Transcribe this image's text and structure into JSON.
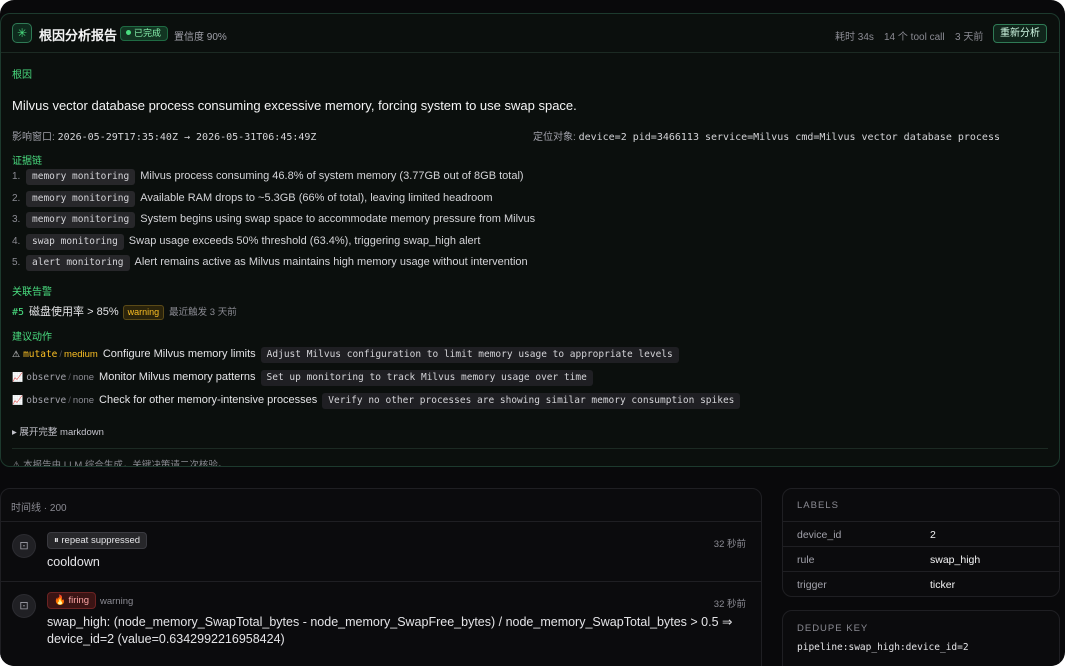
{
  "report": {
    "title": "根因分析报告",
    "status": "已完成",
    "confidence": "置信度 90%",
    "duration": "耗时 34s",
    "tool_calls": "14 个 tool call",
    "age": "3 天前",
    "rerun_label": "重新分析",
    "root_cause_label": "根因",
    "root_cause": "Milvus vector database process consuming excessive memory, forcing system to use swap space.",
    "window_label": "影响窗口:",
    "window_value": "2026-05-29T17:35:40Z → 2026-05-31T06:45:49Z",
    "target_label": "定位对象:",
    "target_value": "device=2 pid=3466113 service=Milvus cmd=Milvus vector database process",
    "evidence_label": "证据链",
    "evidence": [
      {
        "num": "1.",
        "tag": "memory monitoring",
        "text": "Milvus process consuming 46.8% of system memory (3.77GB out of 8GB total)"
      },
      {
        "num": "2.",
        "tag": "memory monitoring",
        "text": "Available RAM drops to ~5.3GB (66% of total), leaving limited headroom"
      },
      {
        "num": "3.",
        "tag": "memory monitoring",
        "text": "System begins using swap space to accommodate memory pressure from Milvus"
      },
      {
        "num": "4.",
        "tag": "swap monitoring",
        "text": "Swap usage exceeds 50% threshold (63.4%), triggering swap_high alert"
      },
      {
        "num": "5.",
        "tag": "alert monitoring",
        "text": "Alert remains active as Milvus maintains high memory usage without intervention"
      }
    ],
    "related_label": "关联告警",
    "related": {
      "id": "#5",
      "text": "磁盘使用率 > 85%",
      "severity": "warning",
      "when": "最近触发 3 天前"
    },
    "actions_label": "建议动作",
    "actions": [
      {
        "icon": "⚠",
        "kind": "mutate",
        "risk": "medium",
        "title": "Configure Milvus memory limits",
        "detail": "Adjust Milvus configuration to limit memory usage to appropriate levels"
      },
      {
        "icon": "📈",
        "kind": "observe",
        "risk": "none",
        "title": "Monitor Milvus memory patterns",
        "detail": "Set up monitoring to track Milvus memory usage over time"
      },
      {
        "icon": "📈",
        "kind": "observe",
        "risk": "none",
        "title": "Check for other memory-intensive processes",
        "detail": "Verify no other processes are showing similar memory consumption spikes"
      }
    ],
    "expand_label": "▸ 展开完整 markdown",
    "disclaimer": "⚠ 本报告由 LLM 综合生成，关键决策请二次核验。"
  },
  "timeline": {
    "header": "时间线 · 200",
    "events": [
      {
        "pill": "⏸ repeat suppressed",
        "severity": "",
        "time": "32 秒前",
        "body": "cooldown"
      },
      {
        "pill": "🔥 firing",
        "severity": "warning",
        "time": "32 秒前",
        "body": "swap_high: (node_memory_SwapTotal_bytes - node_memory_SwapFree_bytes) / node_memory_SwapTotal_bytes > 0.5 ⇒ device_id=2 (value=0.6342992216958424)"
      }
    ]
  },
  "labels": {
    "title": "LABELS",
    "rows": [
      {
        "key": "device_id",
        "value": "2"
      },
      {
        "key": "rule",
        "value": "swap_high"
      },
      {
        "key": "trigger",
        "value": "ticker"
      }
    ]
  },
  "dedupe": {
    "title": "DEDUPE KEY",
    "value": "pipeline:swap_high:device_id=2"
  },
  "colors": {
    "accent": "#4ade80",
    "warning": "#fbbf24",
    "danger": "#fca5a5",
    "background": "#09090b"
  }
}
